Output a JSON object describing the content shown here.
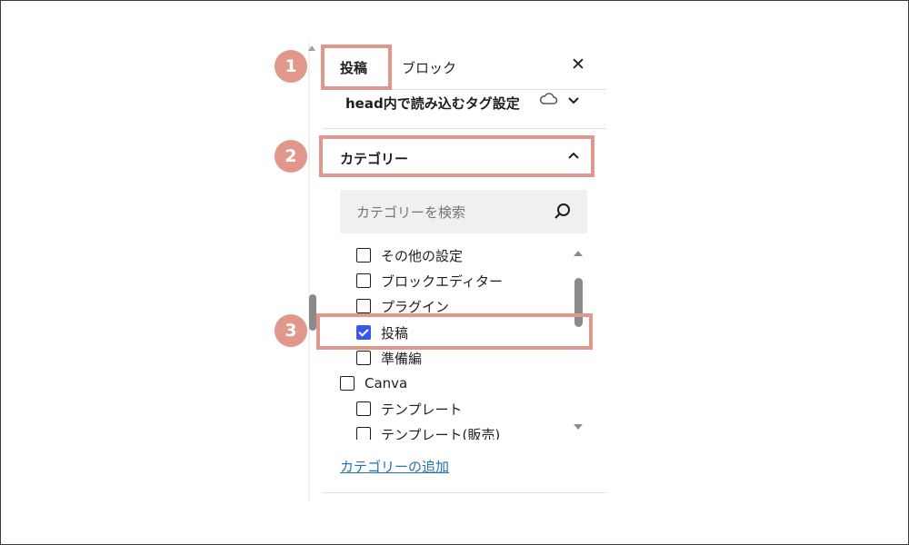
{
  "tabs": [
    {
      "label": "投稿",
      "active": true
    },
    {
      "label": "ブロック",
      "active": false
    }
  ],
  "close_icon": "close-icon",
  "head_section": {
    "title": "head内で読み込むタグ設定",
    "icons": [
      "cloud-icon",
      "chevron-down-icon"
    ]
  },
  "category_section": {
    "title": "カテゴリー",
    "expanded": true,
    "search": {
      "placeholder": "カテゴリーを検索",
      "value": ""
    },
    "items": [
      {
        "label": "その他の設定",
        "checked": false,
        "level": 1
      },
      {
        "label": "ブロックエディター",
        "checked": false,
        "level": 1
      },
      {
        "label": "プラグイン",
        "checked": false,
        "level": 1
      },
      {
        "label": "投稿",
        "checked": true,
        "level": 1
      },
      {
        "label": "準備編",
        "checked": false,
        "level": 1
      },
      {
        "label": "Canva",
        "checked": false,
        "level": 0
      },
      {
        "label": "テンプレート",
        "checked": false,
        "level": 1
      },
      {
        "label": "テンプレート(販売)",
        "checked": false,
        "level": 1
      }
    ],
    "add_link": "カテゴリーの追加"
  },
  "annotations": [
    {
      "number": "1",
      "target": "投稿タブ"
    },
    {
      "number": "2",
      "target": "カテゴリー"
    },
    {
      "number": "3",
      "target": "投稿"
    }
  ],
  "colors": {
    "highlight": "#e0978c",
    "checkbox_checked": "#3858e9",
    "link": "#2271b1"
  }
}
